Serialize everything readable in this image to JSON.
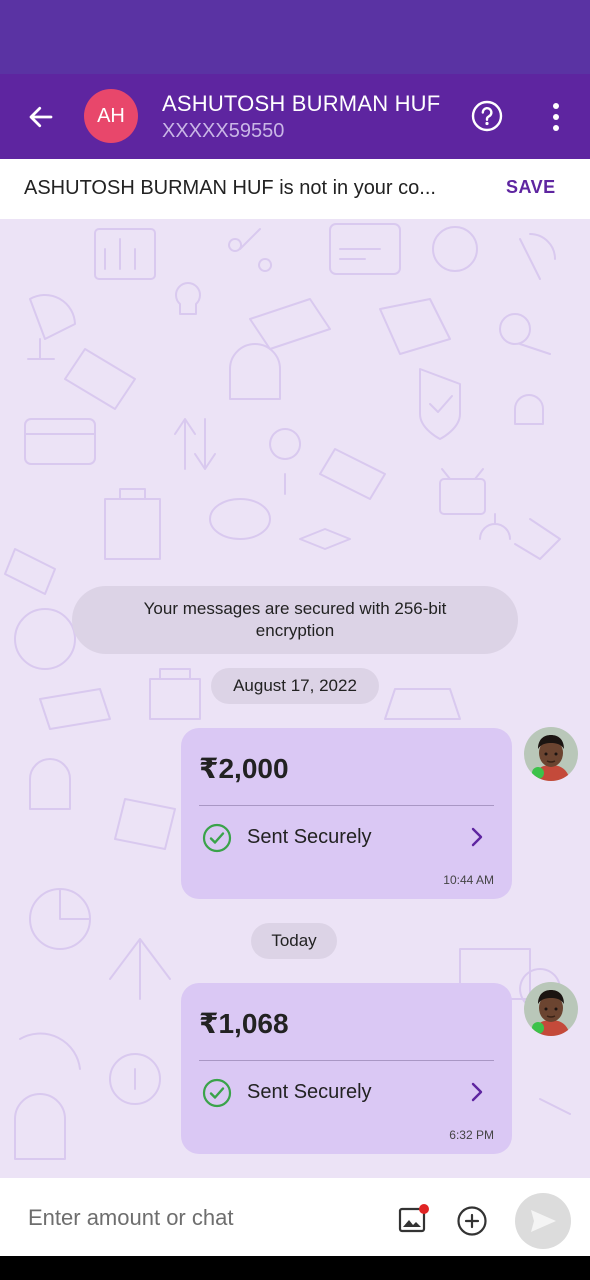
{
  "header": {
    "avatar_initials": "AH",
    "contact_name": "ASHUTOSH BURMAN HUF",
    "contact_number": "XXXXX59550"
  },
  "save_bar": {
    "text": "ASHUTOSH BURMAN HUF is not in your co...",
    "save_label": "SAVE"
  },
  "chat": {
    "encryption_notice": "Your messages are secured with 256-bit encryption",
    "groups": [
      {
        "date": "August 17, 2022",
        "message": {
          "amount": "₹2,000",
          "status": "Sent Securely",
          "time": "10:44 AM"
        }
      },
      {
        "date": "Today",
        "message": {
          "amount": "₹1,068",
          "status": "Sent Securely",
          "time": "6:32 PM"
        }
      }
    ]
  },
  "input": {
    "placeholder": "Enter amount or chat"
  },
  "icons": {
    "back": "arrow-left-icon",
    "help": "help-circle-icon",
    "more": "more-vertical-icon",
    "status_check": "check-circle-icon",
    "chevron": "chevron-right-icon",
    "gallery": "image-icon",
    "add": "plus-circle-icon",
    "send": "send-icon"
  },
  "colors": {
    "header_bg": "#5e25a0",
    "status_bar_bg": "#5a33a3",
    "avatar_bg": "#e8476b",
    "chat_bg": "#ece3f6",
    "bubble_bg": "#dac8f4",
    "accent": "#5e25a0",
    "success_green": "#3aa34a",
    "notification_dot": "#e02424"
  }
}
